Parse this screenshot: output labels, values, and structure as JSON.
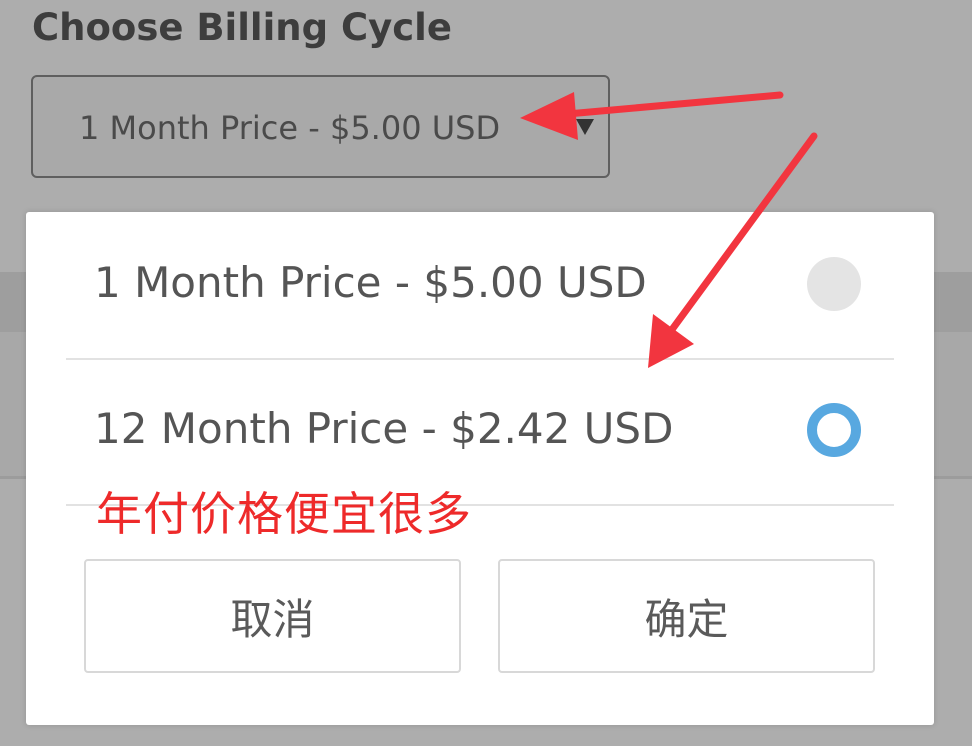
{
  "header": {
    "title": "Choose Billing Cycle"
  },
  "billing_select": {
    "value": "1 Month Price - $5.00 USD"
  },
  "dialog": {
    "options": [
      {
        "label": "1 Month Price - $5.00 USD",
        "selected": false
      },
      {
        "label": "12 Month Price - $2.42 USD",
        "selected": true
      }
    ],
    "cancel_label": "取消",
    "confirm_label": "确定"
  },
  "annotation": {
    "text": "年付价格便宜很多",
    "color": "#ee2a2a"
  },
  "colors": {
    "accent_radio": "#58a8e0",
    "overlay": "#adadad"
  }
}
